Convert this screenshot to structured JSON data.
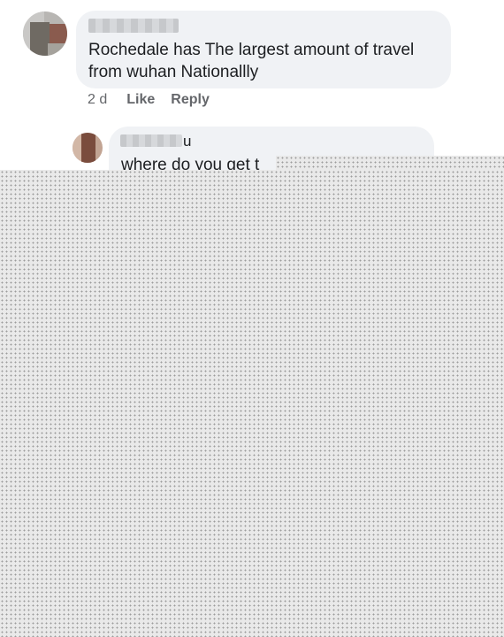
{
  "comments": [
    {
      "author": "",
      "text": "Rochedale has The largest amount of travel\nfrom wuhan Nationallly",
      "time": "2 d",
      "like_label": "Like",
      "reply_label": "Reply"
    }
  ],
  "reply": {
    "author_visible_suffix": "u",
    "text": "where do you get t"
  },
  "colors": {
    "bubble": "#f0f2f5",
    "text": "#1c1e21",
    "meta": "#65676b",
    "mask": "#e9e9e9"
  }
}
